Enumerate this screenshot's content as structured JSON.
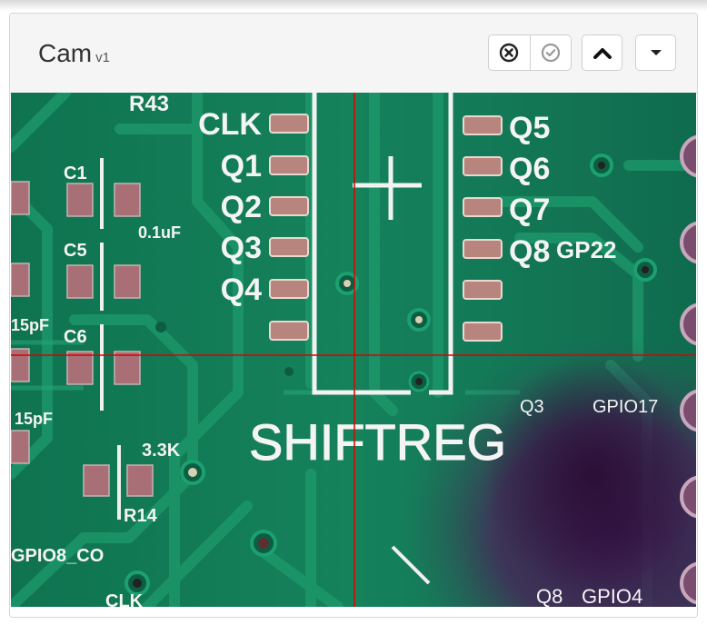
{
  "panel": {
    "title": "Cam",
    "version": "v1"
  },
  "header_buttons": [
    {
      "icon": "cancel-circle-icon"
    },
    {
      "icon": "check-circle-icon"
    },
    {
      "icon": "chevron-up-icon"
    },
    {
      "icon": "caret-down-icon"
    }
  ],
  "camera": {
    "crosshair_color": "#dd0000",
    "silk_labels": {
      "clk": "CLK",
      "q1": "Q1",
      "q2": "Q2",
      "q3": "Q3",
      "q4": "Q4",
      "q5": "Q5",
      "q6": "Q6",
      "q7": "Q7",
      "q8": "Q8",
      "chip": "SHIFTREG",
      "r43": "R43",
      "c1": "C1",
      "cap1": "0.1uF",
      "c5": "C5",
      "cap2": "15pF",
      "c6": "C6",
      "cap3": "15pF",
      "r14": "R14",
      "res": "3.3K",
      "gpio8": "GPIO8_CO",
      "gpio22": "GP22",
      "q8b": "Q8",
      "gpio17": "GPIO17",
      "q3b": "Q3",
      "gpio4": "GPIO4",
      "q8c": "Q8",
      "clkb": "CLK"
    }
  }
}
